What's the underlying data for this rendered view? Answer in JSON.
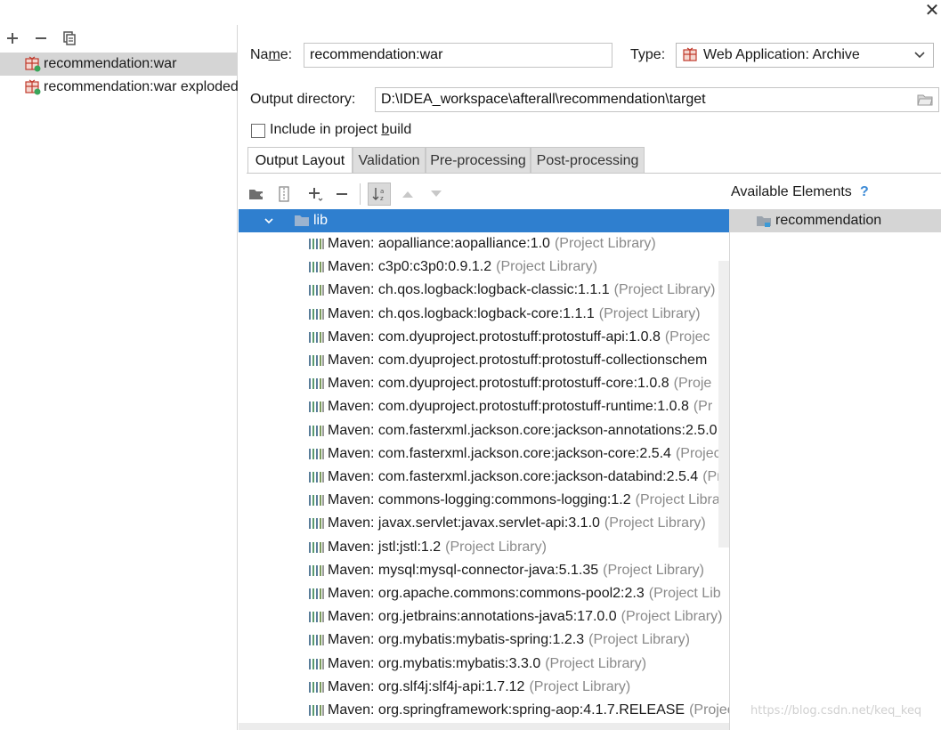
{
  "left": {
    "toolbar": {
      "add_icon": "plus-icon",
      "remove_icon": "minus-icon",
      "copy_icon": "copy-icon"
    },
    "artifacts": [
      {
        "label": "recommendation:war",
        "selected": true
      },
      {
        "label": "recommendation:war exploded",
        "selected": false
      }
    ]
  },
  "form": {
    "name_label_pre": "Na",
    "name_label_m": "m",
    "name_label_post": "e:",
    "name_value": "recommendation:war",
    "type_label": "Type:",
    "type_value": "Web Application: Archive",
    "output_dir_label": "Output directory:",
    "output_dir_value": "D:\\IDEA_workspace\\afterall\\recommendation\\target",
    "include_label_pre": "Include in project ",
    "include_label_b": "b",
    "include_label_post": "uild",
    "include_checked": false
  },
  "tabs": [
    {
      "label": "Output Layout",
      "active": true
    },
    {
      "label": "Validation",
      "active": false
    },
    {
      "label": "Pre-processing",
      "active": false
    },
    {
      "label": "Post-processing",
      "active": false
    }
  ],
  "tree": {
    "folder": "lib",
    "library_suffix": "(Project Library)",
    "items": [
      {
        "name": "Maven: aopalliance:aopalliance:1.0",
        "suffix": "(Project Library)"
      },
      {
        "name": "Maven: c3p0:c3p0:0.9.1.2",
        "suffix": "(Project Library)"
      },
      {
        "name": "Maven: ch.qos.logback:logback-classic:1.1.1",
        "suffix": "(Project Library)"
      },
      {
        "name": "Maven: ch.qos.logback:logback-core:1.1.1",
        "suffix": "(Project Library)"
      },
      {
        "name": "Maven: com.dyuproject.protostuff:protostuff-api:1.0.8",
        "suffix": "(Projec"
      },
      {
        "name": "Maven: com.dyuproject.protostuff:protostuff-collectionschem",
        "suffix": ""
      },
      {
        "name": "Maven: com.dyuproject.protostuff:protostuff-core:1.0.8",
        "suffix": "(Proje"
      },
      {
        "name": "Maven: com.dyuproject.protostuff:protostuff-runtime:1.0.8",
        "suffix": "(Pr"
      },
      {
        "name": "Maven: com.fasterxml.jackson.core:jackson-annotations:2.5.0",
        "suffix": "("
      },
      {
        "name": "Maven: com.fasterxml.jackson.core:jackson-core:2.5.4",
        "suffix": "(Project"
      },
      {
        "name": "Maven: com.fasterxml.jackson.core:jackson-databind:2.5.4",
        "suffix": "(Pro"
      },
      {
        "name": "Maven: commons-logging:commons-logging:1.2",
        "suffix": "(Project Libra"
      },
      {
        "name": "Maven: javax.servlet:javax.servlet-api:3.1.0",
        "suffix": "(Project Library)"
      },
      {
        "name": "Maven: jstl:jstl:1.2",
        "suffix": "(Project Library)"
      },
      {
        "name": "Maven: mysql:mysql-connector-java:5.1.35",
        "suffix": "(Project Library)"
      },
      {
        "name": "Maven: org.apache.commons:commons-pool2:2.3",
        "suffix": "(Project Lib"
      },
      {
        "name": "Maven: org.jetbrains:annotations-java5:17.0.0",
        "suffix": "(Project Library)"
      },
      {
        "name": "Maven: org.mybatis:mybatis-spring:1.2.3",
        "suffix": "(Project Library)"
      },
      {
        "name": "Maven: org.mybatis:mybatis:3.3.0",
        "suffix": "(Project Library)"
      },
      {
        "name": "Maven: org.slf4j:slf4j-api:1.7.12",
        "suffix": "(Project Library)"
      },
      {
        "name": "Maven: org.springframework:spring-aop:4.1.7.RELEASE",
        "suffix": "(Projec"
      }
    ]
  },
  "available": {
    "title": "Available Elements",
    "help": "?",
    "items": [
      "recommendation"
    ]
  },
  "watermark": "https://blog.csdn.net/keq_keq",
  "colors": {
    "selection": "#2f7fcf",
    "secondary_text": "#8a8a8a",
    "help": "#3b8ad6"
  }
}
